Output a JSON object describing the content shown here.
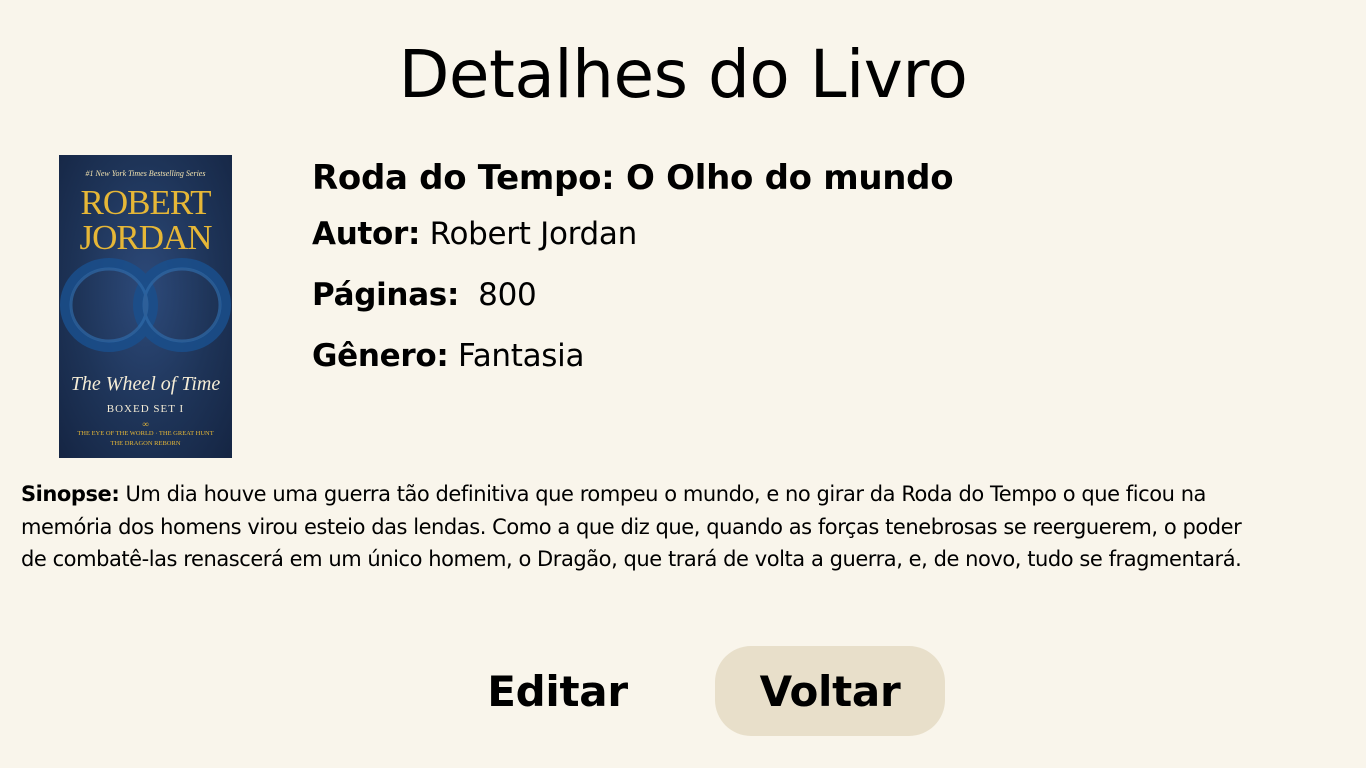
{
  "page": {
    "title": "Detalhes do Livro"
  },
  "cover": {
    "tagline": "#1 New York Times Bestselling Series",
    "author_line1": "ROBERT",
    "author_line2": "JORDAN",
    "series": "The Wheel of Time",
    "boxed": "BOXED SET I",
    "divider": "∞",
    "subtitle_line1": "THE EYE OF THE WORLD · THE GREAT HUNT",
    "subtitle_line2": "THE DRAGON REBORN"
  },
  "book": {
    "title": "Roda do Tempo: O Olho do mundo",
    "author_label": "Autor:",
    "author": "Robert Jordan",
    "pages_label": "Páginas:",
    "pages": "800",
    "genre_label": "Gênero:",
    "genre": "Fantasia",
    "synopsis_label": "Sinopse:",
    "synopsis": "Um dia houve uma guerra tão definitiva que rompeu o mundo, e no girar da Roda do Tempo o que ficou na memória dos homens virou esteio das lendas. Como a que diz que, quando as forças tenebrosas se reerguerem, o poder de combatê-las renascerá em um único homem, o Dragão, que trará de volta a guerra, e, de novo, tudo se fragmentará."
  },
  "actions": {
    "edit_label": "Editar",
    "back_label": "Voltar"
  },
  "colors": {
    "background": "#f9f5eb",
    "back_button_bg": "#e8dfca",
    "cover_gold": "#e6b737",
    "cover_blue": "#1e3458"
  }
}
